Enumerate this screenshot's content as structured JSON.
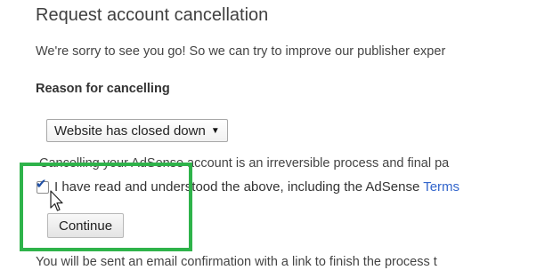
{
  "page": {
    "title": "Request account cancellation",
    "intro": "We're sorry to see you go! So we can try to improve our publisher exper",
    "reason_label": "Reason for cancelling",
    "reason_select": {
      "selected": "Website has closed down",
      "arrow": "▼"
    },
    "warning": "Cancelling your AdSense account is an irreversible process and final pa",
    "checkbox": {
      "checked": true,
      "label_prefix": "I have read and understood the above, including the AdSense ",
      "link_text": "Terms"
    },
    "continue_label": "Continue",
    "footer": "You will be sent an email confirmation with a link to finish the process t"
  },
  "colors": {
    "highlight": "#2eb34a",
    "link": "#3366cc"
  }
}
